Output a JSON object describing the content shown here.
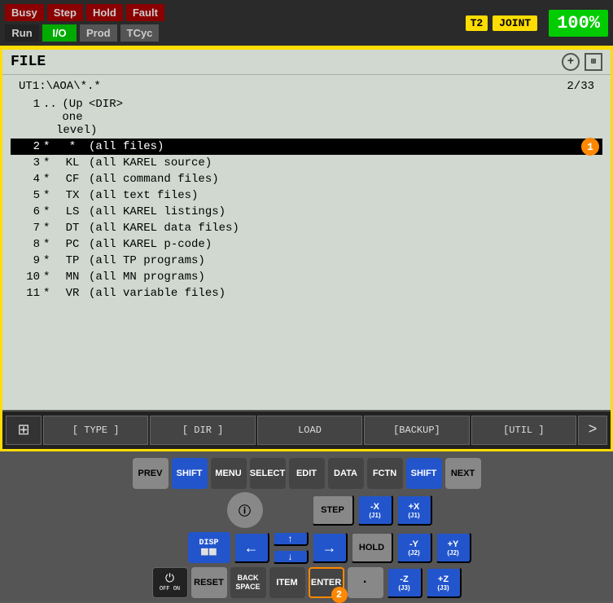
{
  "statusBar": {
    "row1": [
      "Busy",
      "Step",
      "Hold",
      "Fault"
    ],
    "row2": [
      "Run",
      "I/O",
      "Prod",
      "TCyc"
    ],
    "t2Label": "T2",
    "jointLabel": "JOINT",
    "percentLabel": "100",
    "percentSymbol": "%"
  },
  "screen": {
    "title": "FILE",
    "path": "UT1:\\AOA\\*.*",
    "pageInfo": "2/33",
    "rows": [
      {
        "num": "1",
        "star": "..",
        "type": "(Up one level)",
        "desc": "<DIR>",
        "selected": false
      },
      {
        "num": "2",
        "star": "*",
        "type": "*",
        "desc": "(all files)",
        "selected": true,
        "badge": "1"
      },
      {
        "num": "3",
        "star": "*",
        "type": "KL",
        "desc": "(all KAREL source)",
        "selected": false
      },
      {
        "num": "4",
        "star": "*",
        "type": "CF",
        "desc": "(all command files)",
        "selected": false
      },
      {
        "num": "5",
        "star": "*",
        "type": "TX",
        "desc": "(all text files)",
        "selected": false
      },
      {
        "num": "6",
        "star": "*",
        "type": "LS",
        "desc": "(all KAREL listings)",
        "selected": false
      },
      {
        "num": "7",
        "star": "*",
        "type": "DT",
        "desc": "(all KAREL data files)",
        "selected": false
      },
      {
        "num": "8",
        "star": "*",
        "type": "PC",
        "desc": "(all KAREL p-code)",
        "selected": false
      },
      {
        "num": "9",
        "star": "*",
        "type": "TP",
        "desc": "(all TP programs)",
        "selected": false
      },
      {
        "num": "10",
        "star": "*",
        "type": "MN",
        "desc": "(all MN programs)",
        "selected": false
      },
      {
        "num": "11",
        "star": "*",
        "type": "VR",
        "desc": "(all variable files)",
        "selected": false
      }
    ]
  },
  "softkeyBar": {
    "keys": [
      "[ TYPE ]",
      "[ DIR ]",
      "LOAD",
      "[BACKUP]",
      "[UTIL ]"
    ]
  },
  "keyboard": {
    "row1": [
      {
        "label": "PREV",
        "style": "gray"
      },
      {
        "label": "SHIFT",
        "style": "blue"
      },
      {
        "label": "MENU",
        "style": "dark"
      },
      {
        "label": "SELECT",
        "style": "dark"
      },
      {
        "label": "EDIT",
        "style": "dark"
      },
      {
        "label": "DATA",
        "style": "dark"
      },
      {
        "label": "FCTN",
        "style": "dark"
      },
      {
        "label": "SHIFT",
        "style": "blue"
      },
      {
        "label": "NEXT",
        "style": "gray"
      }
    ],
    "row2_left": [
      {
        "label": "ⓘ",
        "style": "info"
      }
    ],
    "row3_left": [
      {
        "label": "DISP",
        "style": "disp"
      }
    ],
    "row4_left": [
      {
        "label": "RESET",
        "style": "gray"
      },
      {
        "label": "BACK\nSPACE",
        "style": "dark"
      },
      {
        "label": "ITEM",
        "style": "dark"
      },
      {
        "label": "ENTER",
        "style": "dark",
        "badge": "2"
      }
    ]
  }
}
